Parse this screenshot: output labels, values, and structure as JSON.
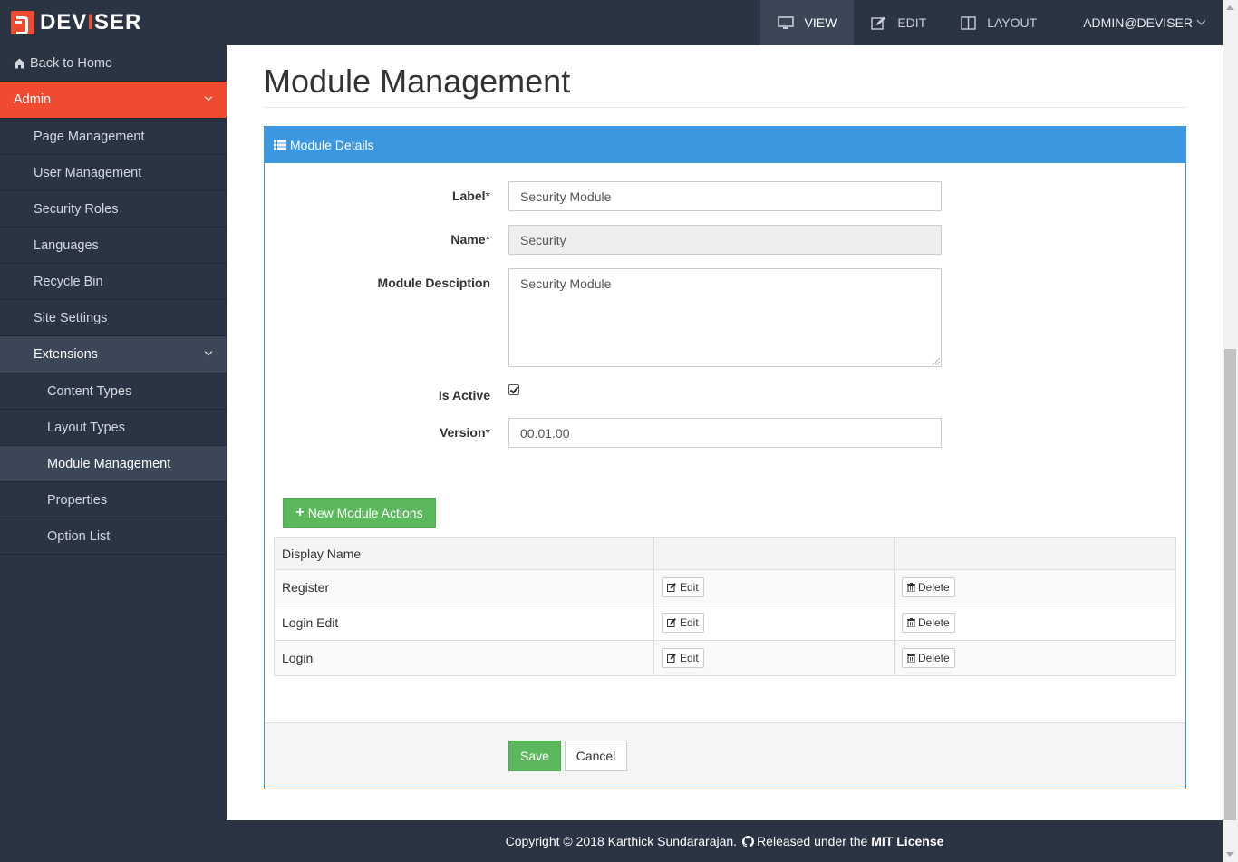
{
  "brand": {
    "name_part1": "DEV",
    "name_accent": "I",
    "name_part2": "SER"
  },
  "topnav": {
    "view": "VIEW",
    "edit": "EDIT",
    "layout": "LAYOUT",
    "user": "ADMIN@DEVISER"
  },
  "sidebar": {
    "back": "Back to Home",
    "admin": "Admin",
    "items": [
      "Page Management",
      "User Management",
      "Security Roles",
      "Languages",
      "Recycle Bin",
      "Site Settings"
    ],
    "extensions": "Extensions",
    "sub_items": [
      "Content Types",
      "Layout Types",
      "Module Management",
      "Properties",
      "Option List"
    ]
  },
  "main": {
    "title": "Module Management",
    "panel_title": "Module Details",
    "form": {
      "label_label": "Label",
      "label_value": "Security Module",
      "name_label": "Name",
      "name_value": "Security",
      "description_label": "Module Desciption",
      "description_value": "Security Module",
      "active_label": "Is Active",
      "is_active": true,
      "version_label": "Version",
      "version_value": "00.01.00",
      "required_mark": "*"
    },
    "new_actions_button": "New Module Actions",
    "table": {
      "headers": [
        "Display Name",
        "",
        ""
      ],
      "rows": [
        {
          "name": "Register",
          "edit": "Edit",
          "delete": "Delete"
        },
        {
          "name": "Login Edit",
          "edit": "Edit",
          "delete": "Delete"
        },
        {
          "name": "Login",
          "edit": "Edit",
          "delete": "Delete"
        }
      ]
    },
    "save_button": "Save",
    "cancel_button": "Cancel"
  },
  "footer": {
    "copyright": "Copyright © 2018 Karthick Sundararajan.",
    "released": "Released under the",
    "license": "MIT License"
  },
  "colors": {
    "navbar": "#2b3442",
    "accent_red": "#f04b31",
    "panel_blue": "#3b97df",
    "success_green": "#5cb85c",
    "active_item": "#3b4656"
  }
}
